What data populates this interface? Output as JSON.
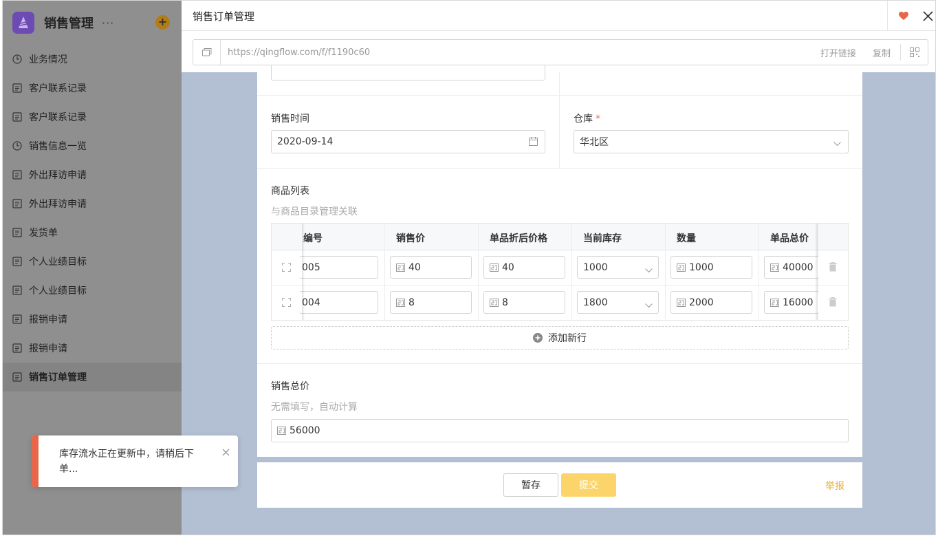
{
  "sidebar": {
    "app_name": "销售管理",
    "more": "···",
    "add": "+",
    "items": [
      {
        "label": "业务情况",
        "icon": "dashboard-icon"
      },
      {
        "label": "客户联系记录",
        "icon": "form-icon"
      },
      {
        "label": "客户联系记录",
        "icon": "form-icon"
      },
      {
        "label": "销售信息一览",
        "icon": "dashboard-icon"
      },
      {
        "label": "外出拜访申请",
        "icon": "form-icon"
      },
      {
        "label": "外出拜访申请",
        "icon": "form-icon"
      },
      {
        "label": "发货单",
        "icon": "form-icon"
      },
      {
        "label": "个人业绩目标",
        "icon": "form-icon"
      },
      {
        "label": "个人业绩目标",
        "icon": "form-icon"
      },
      {
        "label": "报销申请",
        "icon": "form-icon"
      },
      {
        "label": "报销申请",
        "icon": "form-icon"
      },
      {
        "label": "销售订单管理",
        "icon": "form-icon",
        "active": true
      }
    ]
  },
  "toast": {
    "message": "库存流水正在更新中，请稍后下单...",
    "accent": "#e8674a"
  },
  "modal": {
    "title": "销售订单管理",
    "url": "https://qingflow.com/f/f1190c60",
    "open_link": "打开链接",
    "copy": "复制"
  },
  "form": {
    "sale_time_label": "销售时间",
    "sale_time_value": "2020-09-14",
    "warehouse_label": "仓库",
    "warehouse_required": "*",
    "warehouse_value": "华北区",
    "product_list_label": "商品列表",
    "product_list_hint": "与商品目录管理关联",
    "table": {
      "headers": [
        "编号",
        "销售价",
        "单品折后价格",
        "当前库存",
        "数量",
        "单品总价"
      ],
      "rows": [
        {
          "code": "005",
          "price": "40",
          "discount_price": "40",
          "stock": "1000",
          "qty": "1000",
          "total": "40000"
        },
        {
          "code": "004",
          "price": "8",
          "discount_price": "8",
          "stock": "1800",
          "qty": "2000",
          "total": "16000"
        }
      ]
    },
    "add_row": "添加新行",
    "total_label": "销售总价",
    "total_hint": "无需填写，自动计算",
    "total_value": "56000"
  },
  "footer": {
    "save": "暂存",
    "submit": "提交",
    "report": "举报"
  },
  "colors": {
    "accent_orange": "#e8674a",
    "submit_yellow": "#fbd56a",
    "report_gold": "#e8b23f",
    "logo_purple": "#6e4bb3"
  }
}
